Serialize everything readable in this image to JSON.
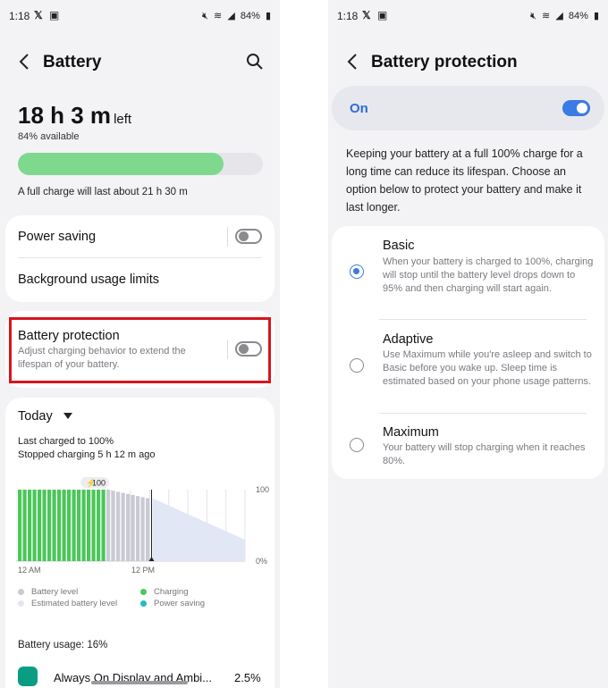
{
  "status_bar": {
    "time": "1:18",
    "left_icons": [
      "x-logo-icon",
      "image-icon"
    ],
    "battery_percent": "84%"
  },
  "left_screen": {
    "title": "Battery",
    "time_left_value": "18 h 3 m",
    "time_left_word": "left",
    "available": "84% available",
    "battery_level": 0.84,
    "full_charge": "A full charge will last about 21 h 30 m",
    "power_saving_label": "Power saving",
    "power_saving_on": false,
    "background_limits_label": "Background usage limits",
    "battery_protection_label": "Battery protection",
    "battery_protection_desc": "Adjust charging behavior to extend the lifespan of your battery.",
    "battery_protection_on": false,
    "today_label": "Today",
    "last_charged": "Last charged to 100%",
    "stopped_charging": "Stopped charging 5 h 12 m ago",
    "chart_badge": "100",
    "battery_usage": "Battery usage: 16%",
    "app_usage": {
      "name": "Always On Display and Ambi...",
      "percent": "2.5%"
    }
  },
  "chart_data": {
    "type": "bar",
    "x_tick_labels": [
      "12 AM",
      "12 PM"
    ],
    "y_tick_labels": [
      "100",
      "0%"
    ],
    "ylim": [
      0,
      100
    ],
    "charging_bars": 18,
    "battery_level_bars": 9,
    "estimated_end_value": 30,
    "legend": [
      {
        "name": "Battery level",
        "color": "#c9cad3"
      },
      {
        "name": "Estimated battery level",
        "color": "#e4e7f2"
      },
      {
        "name": "Charging",
        "color": "#4cc65a"
      },
      {
        "name": "Power saving",
        "color": "#25b9c9"
      }
    ]
  },
  "right_screen": {
    "title": "Battery protection",
    "master_label": "On",
    "master_on": true,
    "description": "Keeping your battery at a full 100% charge for a long time can reduce its lifespan. Choose an option below to protect your battery and make it last longer.",
    "options": [
      {
        "title": "Basic",
        "desc": "When your battery is charged to 100%, charging will stop until the battery level drops down to 95% and then charging will start again.",
        "selected": true
      },
      {
        "title": "Adaptive",
        "desc": "Use Maximum while you're asleep and switch to Basic before you wake up. Sleep time is estimated based on your phone usage patterns.",
        "selected": false
      },
      {
        "title": "Maximum",
        "desc": "Your battery will stop charging when it reaches 80%.",
        "selected": false
      }
    ]
  }
}
